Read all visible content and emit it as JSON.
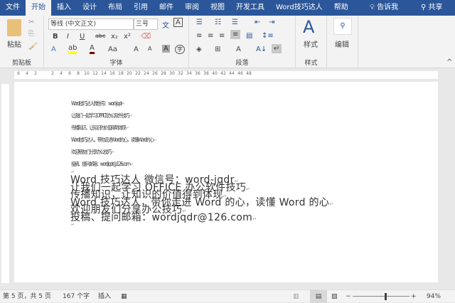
{
  "tabs": [
    "文件",
    "开始",
    "插入",
    "设计",
    "布局",
    "引用",
    "邮件",
    "审阅",
    "视图",
    "开发工具",
    "Word技巧达人",
    "帮助"
  ],
  "tell_me": "告诉我",
  "share": "共享",
  "ribbon": {
    "clipboard": {
      "label": "剪贴板",
      "paste": "粘贴"
    },
    "font": {
      "label": "字体",
      "font_name": "等线 (中文正文)",
      "font_size": "三号",
      "bold": "B",
      "italic": "I",
      "underline": "U",
      "strike": "abc",
      "sub": "x₂",
      "sup": "x²",
      "change_case": "Aa",
      "grow": "A",
      "shrink": "A"
    },
    "paragraph": {
      "label": "段落"
    },
    "styles": {
      "label": "样式",
      "button": "样式"
    },
    "editing": {
      "button": "编辑"
    }
  },
  "ruler_ticks": [
    "6",
    "4",
    "2",
    "",
    "2",
    "4",
    "6",
    "8",
    "10",
    "12",
    "14",
    "16",
    "18",
    "20",
    "22",
    "24",
    "26",
    "28",
    "30",
    "32",
    "34",
    "36",
    "38",
    "40",
    "42",
    "44",
    "46",
    "48"
  ],
  "document": {
    "small_lines": [
      "Word技巧达人微信号：word-jqdr",
      "让我们一起学习OFFICE办公软件技巧",
      "传播知识，让知识的价值得到体现",
      "Word技巧达人，带你走进Word的心，读懂Word的心",
      "欢迎朋友们分享办公技巧",
      "投稿、提问邮箱：wordjqdr@126.com"
    ],
    "big_lines": [
      "Word 技巧达人 微信号：word-jqdr",
      "让我们一起学习 OFFICE 办公软件技巧",
      "传播知识，让知识的价值得到体现",
      "Word 技巧达人，带你走进 Word 的心，读懂 Word 的心",
      "欢迎朋友们分享办公技巧",
      "投稿、提问邮箱：wordjqdr@126.com"
    ],
    "paragraph_mark": "↵"
  },
  "status": {
    "page": "第 5 页，共 5 页",
    "words": "167 个字",
    "mode": "插入",
    "zoom": "94%",
    "zoom_percent": 94
  },
  "colors": {
    "brand": "#2b579a",
    "highlight": "#ffff00",
    "font_color": "#7b0000"
  }
}
